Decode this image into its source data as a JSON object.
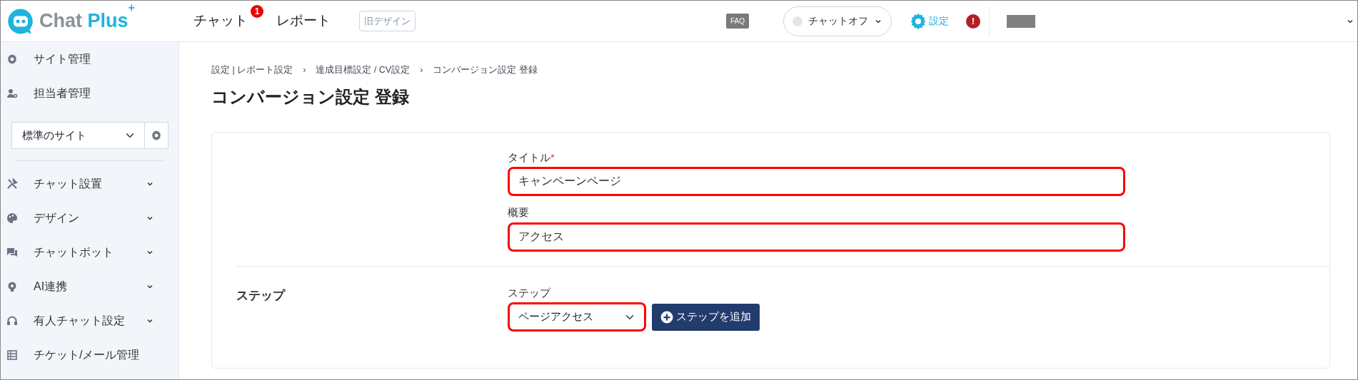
{
  "header": {
    "logo": {
      "word1": "Chat",
      "word2": "Plus",
      "sup": "+"
    },
    "nav": [
      {
        "label": "チャット",
        "badge": "1"
      },
      {
        "label": "レポート"
      }
    ],
    "old_design_button": "旧デザイン",
    "faq": "FAQ",
    "chat_status": {
      "label": "チャットオフ",
      "on": false
    },
    "settings": "設定",
    "alert": "!"
  },
  "sidebar": {
    "top_items": [
      {
        "label": "サイト管理"
      },
      {
        "label": "担当者管理"
      }
    ],
    "site_select": "標準のサイト",
    "menu": [
      {
        "label": "チャット設置",
        "expandable": true
      },
      {
        "label": "デザイン",
        "expandable": true
      },
      {
        "label": "チャットボット",
        "expandable": true
      },
      {
        "label": "AI連携",
        "expandable": true
      },
      {
        "label": "有人チャット設定",
        "expandable": true
      },
      {
        "label": "チケット/メール管理",
        "expandable": false
      }
    ]
  },
  "breadcrumb": {
    "separator": "›",
    "items": [
      "設定 | レポート設定",
      "達成目標設定 / CV設定",
      "コンバージョン設定 登録"
    ]
  },
  "page_title": "コンバージョン設定 登録",
  "form": {
    "fields": [
      {
        "label": "タイトル",
        "required_mark": "*",
        "value": "キャンペーンページ",
        "highlighted": true
      },
      {
        "label": "概要",
        "value": "アクセス",
        "highlighted": true
      }
    ],
    "step_section": {
      "heading": "ステップ",
      "label": "ステップ",
      "select_value": "ページアクセス",
      "highlighted": true,
      "add_button": "ステップを追加"
    }
  }
}
